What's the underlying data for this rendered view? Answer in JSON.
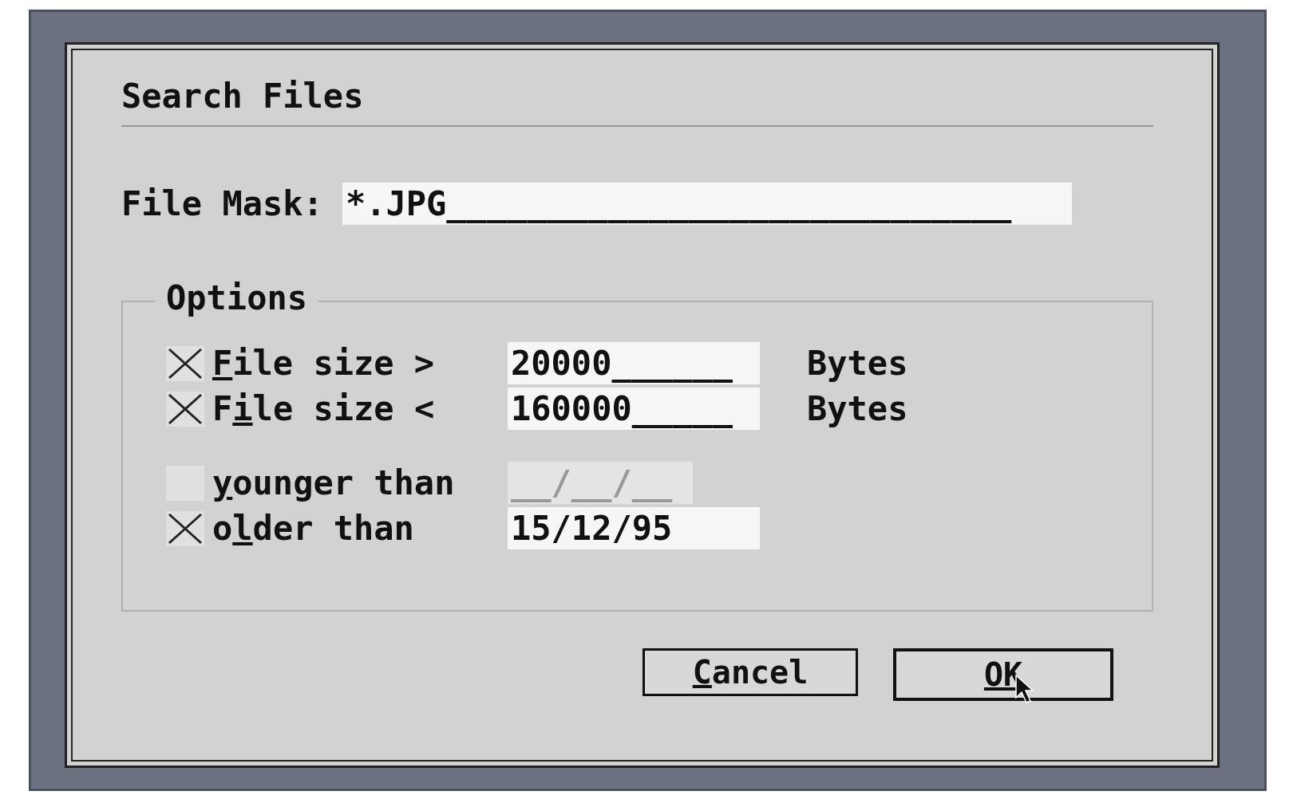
{
  "dialog": {
    "title": "Search Files",
    "file_mask": {
      "label": "File Mask:",
      "value": "*.JPG____________________________"
    },
    "options": {
      "title": "Options",
      "groups": [
        {
          "rows": [
            {
              "checked": true,
              "hotkey": "F",
              "label_after": "ile size >",
              "value": "20000______",
              "disabled": false,
              "unit": "Bytes"
            },
            {
              "checked": true,
              "label_before": "F",
              "hotkey": "i",
              "label_after": "le size <",
              "value": "160000_____",
              "disabled": false,
              "unit": "Bytes"
            }
          ]
        },
        {
          "rows": [
            {
              "checked": false,
              "hotkey": "y",
              "label_after": "ounger than",
              "placeholder": "__/__/__",
              "disabled": true
            },
            {
              "checked": true,
              "label_before": "o",
              "hotkey": "l",
              "label_after": "der than",
              "value": "15/12/95",
              "disabled": false
            }
          ]
        }
      ]
    },
    "buttons": [
      {
        "hotkey": "C",
        "label_after": "ancel",
        "default": false
      },
      {
        "hotkey": "OK",
        "default": true
      }
    ]
  }
}
